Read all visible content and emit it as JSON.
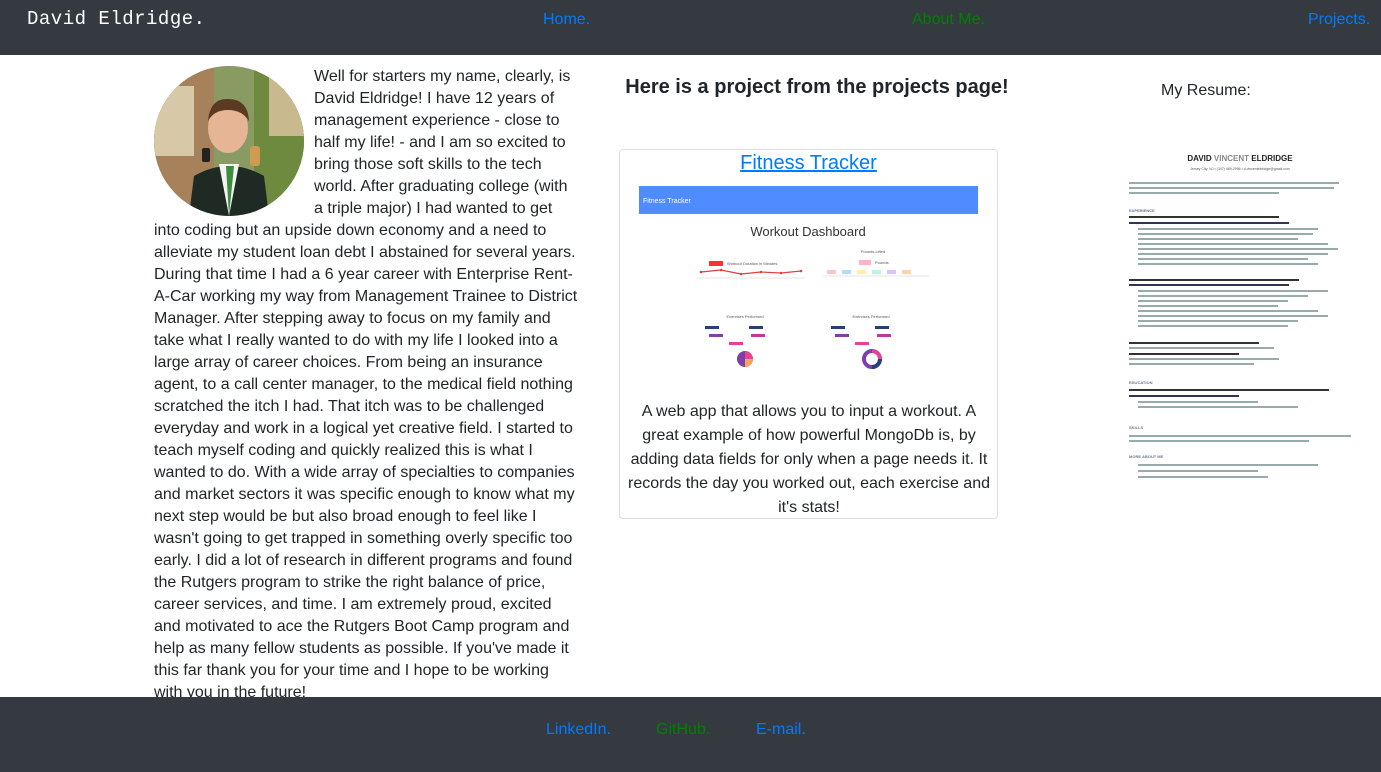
{
  "navbar": {
    "brand": "David Eldridge.",
    "links": [
      {
        "label": "Home.",
        "color": "#007bff"
      },
      {
        "label": "About Me.",
        "color": "#008000"
      },
      {
        "label": "Projects.",
        "color": "#007bff"
      }
    ]
  },
  "about": {
    "avatar_icon": "profile-photo",
    "text": "Well for starters my name, clearly, is David Eldridge! I have 12 years of management experience - close to half my life! - and I am so excited to bring those soft skills to the tech world. After graduating college (with a triple major) I had wanted to get into coding but an upside down economy and a need to alleviate my student loan debt I abstained for several years. During that time I had a 6 year career with Enterprise Rent-A-Car working my way from Management Trainee to District Manager. After stepping away to focus on my family and take what I really wanted to do with my life I looked into a large array of career choices. From being an insurance agent, to a call center manager, to the medical field nothing scratched the itch I had. That itch was to be challenged everyday and work in a logical yet creative field. I started to teach myself coding and quickly realized this is what I wanted to do. With a wide array of specialties to companies and market sectors it was specific enough to know what my next step would be but also broad enough to feel like I wasn't going to get trapped in something overly specific too early. I did a lot of research in different programs and found the Rutgers program to strike the right balance of price, career services, and time. I am extremely proud, excited and motivated to ace the Rutgers Boot Camp program and help as many fellow students as possible. If you've made it this far thank you for your time and I hope to be working with you in the future!"
  },
  "project": {
    "heading": "Here is a project from the projects page!",
    "card": {
      "title": "Fitness Tracker",
      "description": "A web app that allows you to input a workout. A great example of how powerful MongoDb is, by adding data fields for only when a page needs it. It records the day you worked out, each exercise and it's stats!",
      "screenshot": {
        "navbar_label": "Fitness Tracker",
        "dashboard_title": "Workout Dashboard",
        "chart1_legend": "Workout Duration in Minutes",
        "chart2_title": "Pounds Lifted",
        "chart2_legend": "Pounds",
        "chart3_title": "Exercises Performed",
        "chart4_title": "Exercises Performed",
        "legend_items": [
          "Military Press",
          "Bench Press",
          "Squat Press",
          "Running",
          "Push Press"
        ],
        "accent": "#4e8cff"
      }
    }
  },
  "resume": {
    "label": "My Resume:",
    "name_first": "DAVID",
    "name_middle": "VINCENT",
    "name_last": "ELDRIDGE",
    "contact": "Jersey City, NJ • (347) 469-2996 • d.vincenteldridge@gmail.com",
    "summary": "High-performing customer service, sales and operations manager who uses big-picture strategy to execute effectively in the day-to-day. Looking to bring skills and experience to a socially responsible company that is as invested in its stakeholders as its shareholders.",
    "sections": [
      {
        "heading": "EXPERIENCE"
      },
      {
        "heading": "EDUCATION"
      },
      {
        "heading": "SKILLS"
      },
      {
        "heading": "MORE ABOUT ME"
      }
    ]
  },
  "footer": {
    "links": [
      {
        "label": "LinkedIn.",
        "color": "#007bff"
      },
      {
        "label": "GitHub.",
        "color": "#008000"
      },
      {
        "label": "E-mail.",
        "color": "#007bff"
      }
    ]
  },
  "colors": {
    "nav_bg": "#343a40",
    "link_blue": "#007bff",
    "link_green": "#008000"
  }
}
